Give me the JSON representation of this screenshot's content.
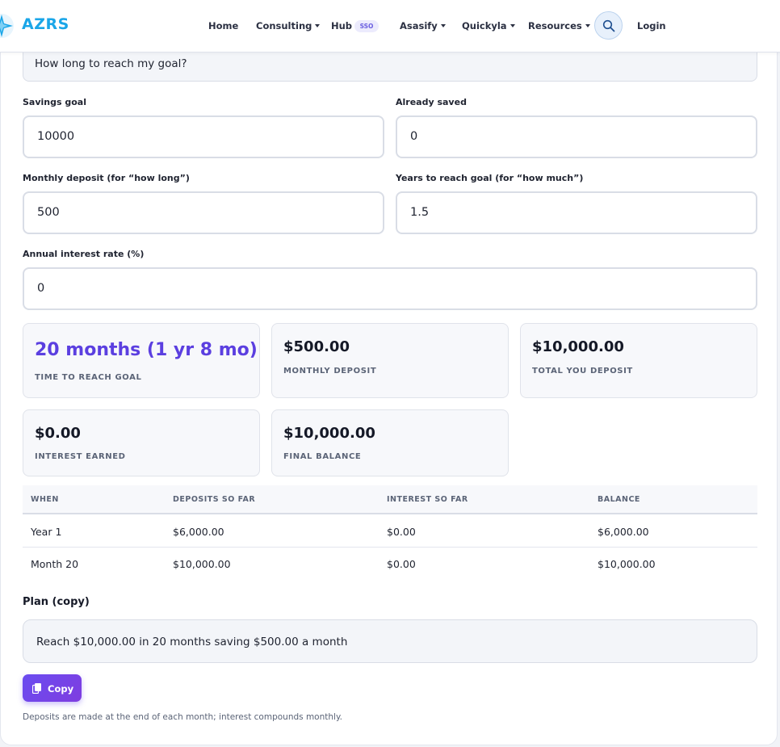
{
  "brand": {
    "name": "AZRS"
  },
  "nav": {
    "home": "Home",
    "consulting": "Consulting",
    "hub": "Hub",
    "hub_badge": "SSO",
    "asasify": "Asasify",
    "quickyla": "Quickyla",
    "resources": "Resources",
    "login": "Login"
  },
  "form": {
    "mode_value": "How long to reach my goal?",
    "savings_goal": {
      "label": "Savings goal",
      "value": "10000"
    },
    "already_saved": {
      "label": "Already saved",
      "value": "0"
    },
    "monthly_deposit": {
      "label": "Monthly deposit (for “how long”)",
      "value": "500"
    },
    "years_to_goal": {
      "label": "Years to reach goal (for “how much”)",
      "value": "1.5"
    },
    "interest_rate": {
      "label": "Annual interest rate (%)",
      "value": "0"
    }
  },
  "results": {
    "time_to_goal": {
      "value": "20 months (1 yr 8 mo)",
      "label": "TIME TO REACH GOAL"
    },
    "monthly_deposit": {
      "value": "$500.00",
      "label": "MONTHLY DEPOSIT"
    },
    "total_deposit": {
      "value": "$10,000.00",
      "label": "TOTAL YOU DEPOSIT"
    },
    "interest_earned": {
      "value": "$0.00",
      "label": "INTEREST EARNED"
    },
    "final_balance": {
      "value": "$10,000.00",
      "label": "FINAL BALANCE"
    }
  },
  "table": {
    "headers": [
      "WHEN",
      "DEPOSITS SO FAR",
      "INTEREST SO FAR",
      "BALANCE"
    ],
    "rows": [
      [
        "Year 1",
        "$6,000.00",
        "$0.00",
        "$6,000.00"
      ],
      [
        "Month 20",
        "$10,000.00",
        "$0.00",
        "$10,000.00"
      ]
    ]
  },
  "plan": {
    "title": "Plan (copy)",
    "text": "Reach $10,000.00 in 20 months saving $500.00 a month",
    "copy_label": "Copy"
  },
  "note": "Deposits are made at the end of each month; interest compounds monthly.",
  "colors": {
    "accent": "#5b3fe0",
    "brand": "#1aa6e8",
    "button": "#6a4cf0"
  }
}
